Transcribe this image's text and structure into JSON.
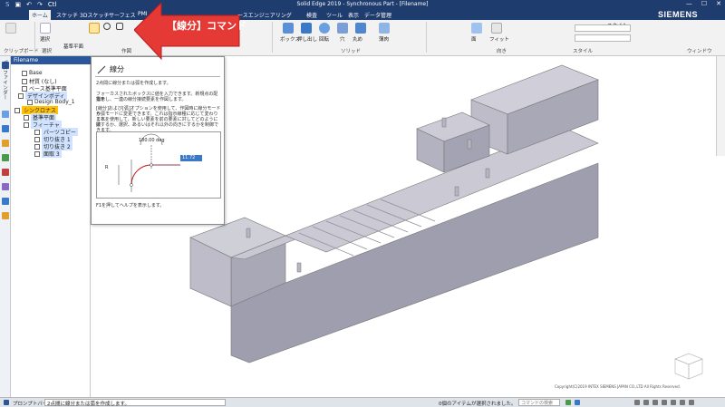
{
  "app": {
    "title": "Solid Edge 2019 - Synchronous Part - [Filename]",
    "brand": "SIEMENS",
    "qa_label": "Ctl"
  },
  "tabs": [
    {
      "label": "ホーム",
      "active": true
    },
    {
      "label": "スケッチ"
    },
    {
      "label": "3Dスケッチ"
    },
    {
      "label": "サーフェス"
    },
    {
      "label": "PMI"
    },
    {
      "label": "ースエンジニアリング"
    },
    {
      "label": "検査"
    },
    {
      "label": "ツール"
    },
    {
      "label": "表示"
    },
    {
      "label": "データ管理"
    }
  ],
  "ribbon": {
    "select_label": "選択",
    "clipboard_label": "クリップボード",
    "select_group": "選択",
    "plane_label": "基準平面",
    "draw_group": "作図",
    "box_label": "ボックス",
    "extrude_label": "押し出し",
    "revolve_label": "回転",
    "hole_label": "穴",
    "round_label": "丸め",
    "thin_label": "薄肉",
    "solid_group": "ソリッド",
    "face_label": "面",
    "fit_label": "フィット",
    "style_label": "スタイル",
    "window_group": "ウィンドウ",
    "style_group": "スタイル",
    "orient_group": "向き"
  },
  "callout": {
    "text": "【線分】コマンド",
    "color": "#e53935"
  },
  "tooltip": {
    "title": "線分",
    "desc1": "2点間に線分または弧を作成します。",
    "desc2": "フォーカスされたボックスに値を入力できます。新規点の配置を",
    "desc3": "指示し、一連の線分接続要素を作図します。",
    "desc4": "[線分]および[弧]オプションを使用して、作図時に線分モードか",
    "desc5": "ら弧モードに変更できます。これは指示線種に応じて変わります。",
    "desc6": "これを使用して、新しい要素を前の要素に対してどのように接",
    "desc7": "続するか、選択、あるいはそれ以外の向きにするかを制御できます。",
    "angle": "180.00 deg",
    "length": "11.72 mm",
    "radius": "R",
    "footer": "F1を押してヘルプを表示します。"
  },
  "tree": {
    "header": "Filename",
    "items": [
      {
        "label": "Base"
      },
      {
        "label": "材質 (なし)"
      },
      {
        "label": "ベース基準平面"
      },
      {
        "label": "デザインボディ"
      },
      {
        "label": "Design Body_1"
      },
      {
        "label": "シンクロナス"
      },
      {
        "label": "基準平面"
      },
      {
        "label": "フィーチャ"
      },
      {
        "label": "パーツコピー"
      },
      {
        "label": "切り抜き 1"
      },
      {
        "label": "切り抜き 2"
      },
      {
        "label": "面取 3"
      }
    ],
    "vertical_label": "パスファインダー"
  },
  "status": {
    "prompt_bar": "プロンプトバー",
    "message": "2点間に線分または弧を作成します。",
    "selection": "0個のアイテムが選択されました。",
    "search_placeholder": "コマンドの検索"
  },
  "viewport": {
    "copyright": "Copyright(C)2019 INTEX SIEMENS JAPAN CO.,LTD All Rights Reserved."
  },
  "colors": {
    "titlebar": "#1f3c6e",
    "accent": "#2b579a",
    "highlight": "#ffc000",
    "model_top": "#c9c8d2",
    "model_side": "#aeadba",
    "model_front": "#9f9eae"
  }
}
